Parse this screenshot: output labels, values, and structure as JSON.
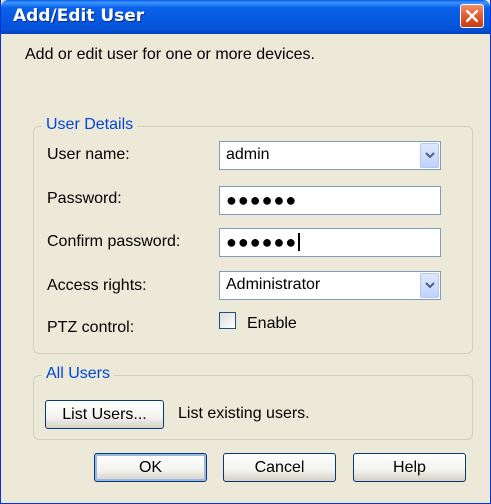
{
  "window": {
    "title": "Add/Edit User"
  },
  "intro": "Add or edit user for one or more devices.",
  "user_details": {
    "group_label": "User Details",
    "username": {
      "label": "User name:",
      "value": "admin"
    },
    "password": {
      "label": "Password:",
      "value": "●●●●●●"
    },
    "confirm_password": {
      "label": "Confirm password:",
      "value": "●●●●●●"
    },
    "access_rights": {
      "label": "Access rights:",
      "value": "Administrator"
    },
    "ptz": {
      "label": "PTZ control:",
      "checkbox_label": "Enable",
      "checked": false
    }
  },
  "all_users": {
    "group_label": "All Users",
    "list_button": "List Users...",
    "description": "List existing users."
  },
  "buttons": {
    "ok": "OK",
    "cancel": "Cancel",
    "help": "Help"
  },
  "colors": {
    "titlebar": "#0a5fe8",
    "dialog_bg": "#ece9d8",
    "group_label": "#0046d5",
    "close_button": "#e25c30"
  }
}
